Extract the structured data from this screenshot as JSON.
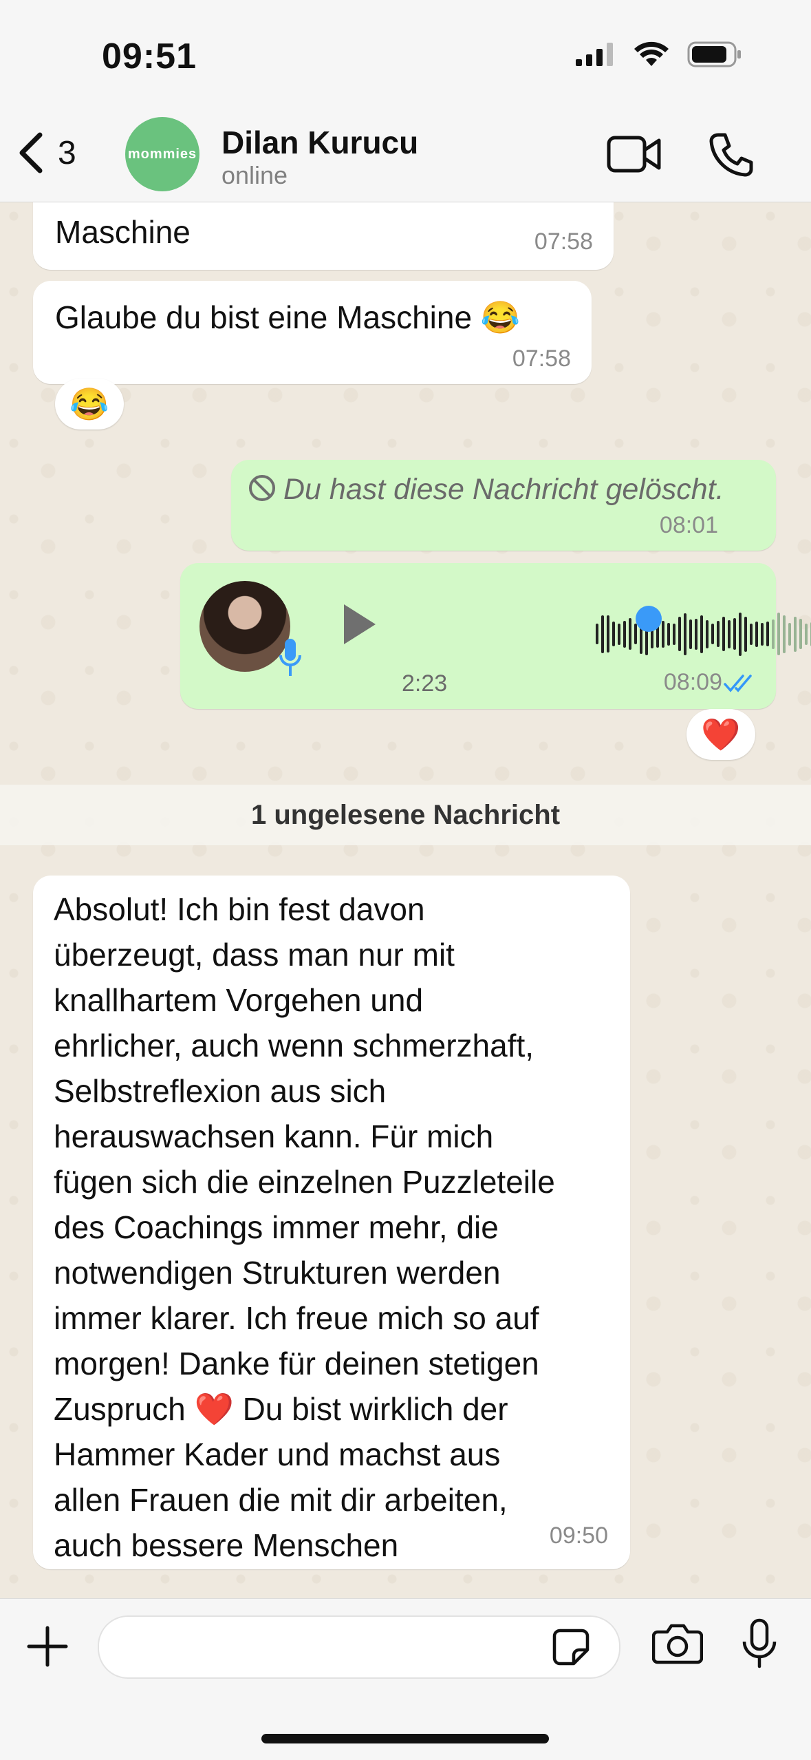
{
  "status_bar": {
    "time": "09:51"
  },
  "header": {
    "back_count": "3",
    "avatar_text": "mommies",
    "contact_name": "Dilan Kurucu",
    "contact_status": "online"
  },
  "messages": [
    {
      "direction": "in",
      "text": "Maschine",
      "time": "07:58"
    },
    {
      "direction": "in",
      "text": "Glaube du bist eine Maschine 😂",
      "time": "07:58",
      "reaction": "😂"
    },
    {
      "direction": "out",
      "text": "Du hast diese Nachricht gelöscht.",
      "time": "08:01",
      "deleted": true
    },
    {
      "direction": "out",
      "type": "voice",
      "duration": "2:23",
      "time": "08:09",
      "read": true,
      "reaction": "❤️",
      "progress_fraction": 0.66
    }
  ],
  "unread_divider": "1 ungelesene Nachricht",
  "incoming_long": {
    "lines": [
      "Absolut! Ich bin fest davon",
      "überzeugt, dass man nur mit",
      "knallhartem Vorgehen und",
      "ehrlicher, auch wenn schmerzhaft,",
      "Selbstreflexion aus sich",
      "herauswachsen kann. Für mich",
      "fügen sich die einzelnen Puzzleteile",
      "des Coachings immer mehr, die",
      "notwendigen Strukturen werden",
      "immer klarer. Ich freue mich so auf",
      "morgen! Danke für deinen stetigen",
      "Zuspruch ❤️ Du bist wirklich der",
      "Hammer Kader und machst aus",
      "allen Frauen die mit dir arbeiten,",
      "auch bessere Menschen"
    ],
    "time": "09:50"
  },
  "input": {
    "placeholder": ""
  },
  "colors": {
    "outgoing": "#d3f9c8",
    "incoming": "#ffffff",
    "read_ticks": "#3497f9",
    "avatar": "#6ac27e"
  }
}
